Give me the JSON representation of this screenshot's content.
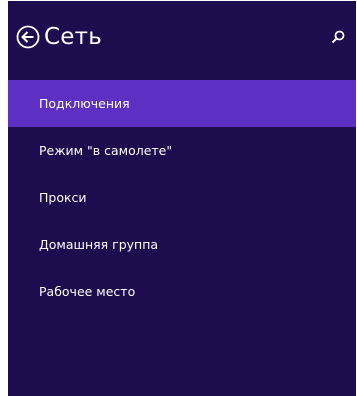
{
  "header": {
    "title": "Сеть",
    "back_icon": "back-arrow-circle-icon",
    "search_icon": "search-icon"
  },
  "menu": {
    "items": [
      {
        "label": "Подключения",
        "selected": true
      },
      {
        "label": "Режим \"в самолете\"",
        "selected": false
      },
      {
        "label": "Прокси",
        "selected": false
      },
      {
        "label": "Домашняя группа",
        "selected": false
      },
      {
        "label": "Рабочее место",
        "selected": false
      }
    ]
  },
  "colors": {
    "panel_background": "#1d0d4f",
    "selected_background": "#5d2fc2",
    "text": "#ffffff"
  }
}
